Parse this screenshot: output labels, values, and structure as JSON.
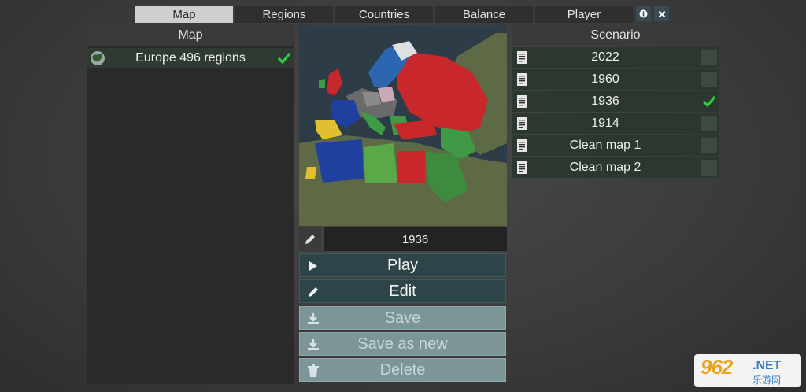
{
  "tabs": [
    {
      "label": "Map",
      "active": true
    },
    {
      "label": "Regions",
      "active": false
    },
    {
      "label": "Countries",
      "active": false
    },
    {
      "label": "Balance",
      "active": false
    },
    {
      "label": "Player",
      "active": false
    }
  ],
  "toolbar": {
    "info_icon": "info-icon",
    "close_icon": "close-icon"
  },
  "left_panel": {
    "title": "Map",
    "maps": [
      {
        "name": "Europe 496 regions",
        "selected": true,
        "icon": "globe-icon"
      }
    ]
  },
  "center": {
    "scenario_name": "1936",
    "buttons": {
      "play": "Play",
      "edit": "Edit",
      "save": "Save",
      "save_as_new": "Save as new",
      "delete": "Delete"
    }
  },
  "right_panel": {
    "title": "Scenario",
    "scenarios": [
      {
        "label": "2022",
        "selected": false
      },
      {
        "label": "1960",
        "selected": false
      },
      {
        "label": "1936",
        "selected": true
      },
      {
        "label": "1914",
        "selected": false
      },
      {
        "label": "Clean map 1",
        "selected": false
      },
      {
        "label": "Clean map 2",
        "selected": false
      }
    ]
  },
  "watermark": {
    "number": "962",
    "suffix": ".NET",
    "cn": "乐游网"
  },
  "colors": {
    "check": "#2ecc40",
    "accent_button": "#2d4548",
    "disabled_button": "#7c9597"
  }
}
